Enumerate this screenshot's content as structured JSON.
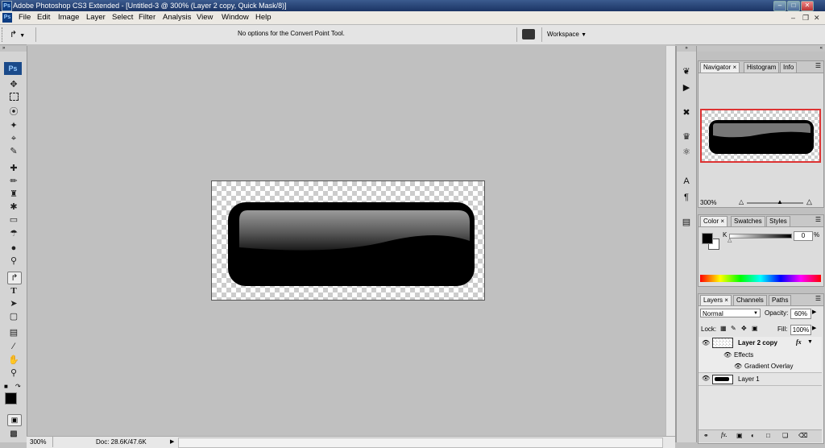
{
  "title_bar": {
    "logo": "Ps",
    "text": "Adobe Photoshop CS3 Extended - [Untitled-3 @ 300% (Layer 2 copy, Quick Mask/8)]",
    "buttons": [
      "minimize",
      "maximize",
      "close"
    ]
  },
  "menu_bar": {
    "logo": "Ps",
    "items": [
      "File",
      "Edit",
      "Image",
      "Layer",
      "Select",
      "Filter",
      "Analysis",
      "View",
      "Window",
      "Help"
    ]
  },
  "options_bar": {
    "message": "No options for the Convert Point Tool.",
    "workspace_label": "Workspace"
  },
  "toolbox": {
    "logo": "Ps",
    "tools": [
      "move-tool",
      "marquee-tool",
      "lasso-tool",
      "magic-wand-tool",
      "crop-tool",
      "slice-tool",
      "healing-brush-tool",
      "brush-tool",
      "clone-stamp-tool",
      "history-brush-tool",
      "eraser-tool",
      "paint-bucket-tool",
      "blur-tool",
      "dodge-tool",
      "convert-point-tool",
      "type-tool",
      "path-selection-tool",
      "shape-tool",
      "notes-tool",
      "eyedropper-tool",
      "hand-tool",
      "zoom-tool"
    ],
    "foreground_color": "#000000",
    "background_color": "#ffffff"
  },
  "status_bar": {
    "zoom": "300%",
    "doc": "Doc: 28.6K/47.6K"
  },
  "navigator": {
    "tabs": [
      "Navigator",
      "Histogram",
      "Info"
    ],
    "zoom": "300%"
  },
  "color_panel": {
    "tabs": [
      "Color",
      "Swatches",
      "Styles"
    ],
    "channel": "K",
    "value": "0",
    "unit": "%"
  },
  "layers_panel": {
    "tabs": [
      "Layers",
      "Channels",
      "Paths"
    ],
    "blend_mode": "Normal",
    "opacity_label": "Opacity:",
    "opacity": "60%",
    "lock_label": "Lock:",
    "fill_label": "Fill:",
    "fill": "100%",
    "layers": [
      {
        "name": "Layer 2 copy",
        "fx": "fx",
        "effects_label": "Effects",
        "effect": "Gradient Overlay"
      },
      {
        "name": "Layer 1"
      }
    ]
  }
}
